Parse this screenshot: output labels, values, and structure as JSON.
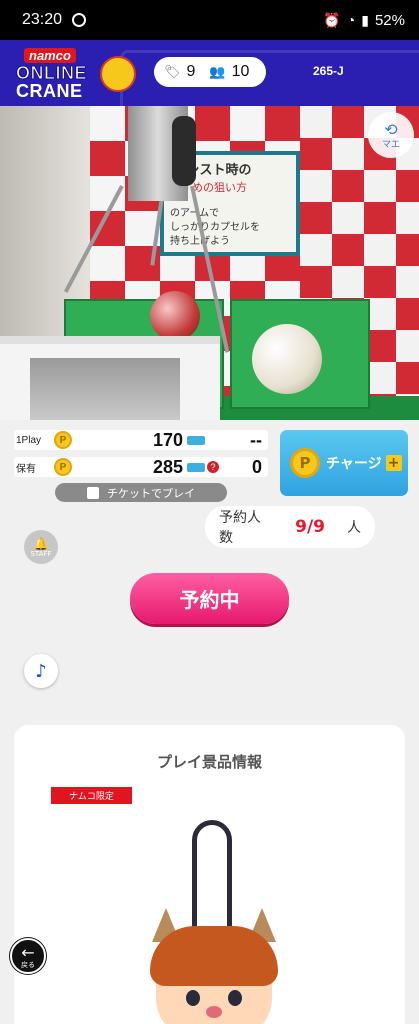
{
  "status_bar": {
    "time": "23:20",
    "battery": "52%"
  },
  "header": {
    "logo_namco": "namco",
    "logo_online": "ONLINE",
    "logo_crane": "CRANE",
    "tickets_count": "9",
    "players_count": "10",
    "machine_id": "265-J"
  },
  "camera": {
    "poster_line1": "アシスト時の",
    "poster_line2": "すすめの狙い方",
    "poster_line3": "のアームで\nしっかりカプセルを\n持ち上げよう",
    "my_camera_label": "マエ"
  },
  "play_info": {
    "one_play_label": "1Play",
    "one_play_cost": "170",
    "one_play_tickets": "--",
    "owned_label": "保有",
    "owned_points": "285",
    "owned_tickets": "0",
    "ticket_play_label": "チケットでプレイ"
  },
  "charge_button": {
    "label": "チャージ"
  },
  "staff": {
    "label": "STAFF"
  },
  "reservation": {
    "label": "予約人数",
    "count": "9/9",
    "unit": "人",
    "button_label": "予約中"
  },
  "prize": {
    "section_title": "プレイ景品情報",
    "badge": "ナムコ限定"
  },
  "back": {
    "label": "戻る"
  }
}
